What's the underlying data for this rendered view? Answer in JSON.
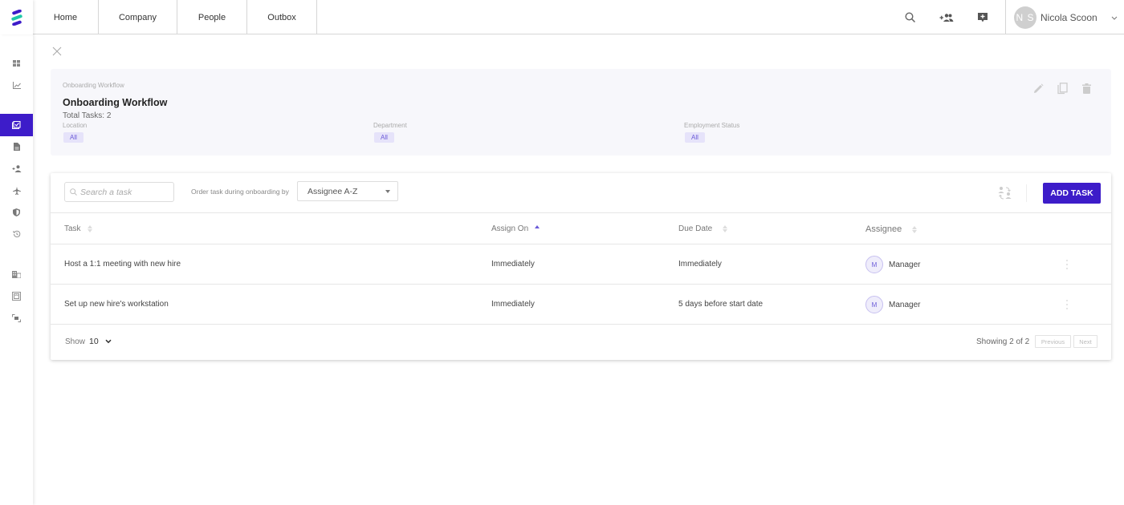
{
  "app": {
    "logo": "brand-logo",
    "nav": [
      {
        "label": "Home"
      },
      {
        "label": "Company"
      },
      {
        "label": "People"
      },
      {
        "label": "Outbox"
      }
    ],
    "top_icons": [
      "search-icon",
      "add-people-icon",
      "feedback-icon"
    ],
    "user": {
      "initials": "N S",
      "name": "Nicola Scoon"
    }
  },
  "sidebar": {
    "items": [
      {
        "icon": "dashboard-icon",
        "active": false
      },
      {
        "icon": "analytics-icon",
        "active": false
      },
      {
        "icon": "onboarding-icon",
        "active": true
      },
      {
        "icon": "document-icon",
        "active": false
      },
      {
        "icon": "people-icon",
        "active": false
      },
      {
        "icon": "travel-icon",
        "active": false
      },
      {
        "icon": "security-icon",
        "active": false
      },
      {
        "icon": "history-icon",
        "active": false
      },
      {
        "icon": "company-icon",
        "active": false
      },
      {
        "icon": "frame-icon",
        "active": false
      },
      {
        "icon": "transfer-icon",
        "active": false
      }
    ]
  },
  "workflow": {
    "breadcrumb": "Onboarding Workflow",
    "title": "Onboarding Workflow",
    "total_tasks": "Total Tasks: 2",
    "filters": [
      {
        "label": "Location",
        "value": "All"
      },
      {
        "label": "Department",
        "value": "All"
      },
      {
        "label": "Employment Status",
        "value": "All"
      }
    ]
  },
  "tasks": {
    "search_placeholder": "Search a task",
    "order_label": "Order task during onboarding by",
    "order_value": "Assignee A-Z",
    "add_button": "ADD TASK",
    "columns": [
      "Task",
      "Assign On",
      "Due Date",
      "Assignee"
    ],
    "sorted_column": "Assign On",
    "sort_direction": "ascending",
    "rows": [
      {
        "task": "Host a 1:1 meeting with new hire",
        "assign_on": "Immediately",
        "due_date": "Immediately",
        "assignee_initial": "M",
        "assignee": "Manager"
      },
      {
        "task": "Set up new hire's workstation",
        "assign_on": "Immediately",
        "due_date": "5 days before start date",
        "assignee_initial": "M",
        "assignee": "Manager"
      }
    ],
    "footer": {
      "show_label": "Show",
      "show_value": "10",
      "showing": "Showing 2 of 2",
      "previous": "Previous",
      "next": "Next"
    }
  },
  "colors": {
    "brand": "#3d1cc9",
    "brand_teal": "#1fc9a8",
    "chip_bg": "#e6e3fa",
    "chip_text": "#6a5ad8"
  }
}
